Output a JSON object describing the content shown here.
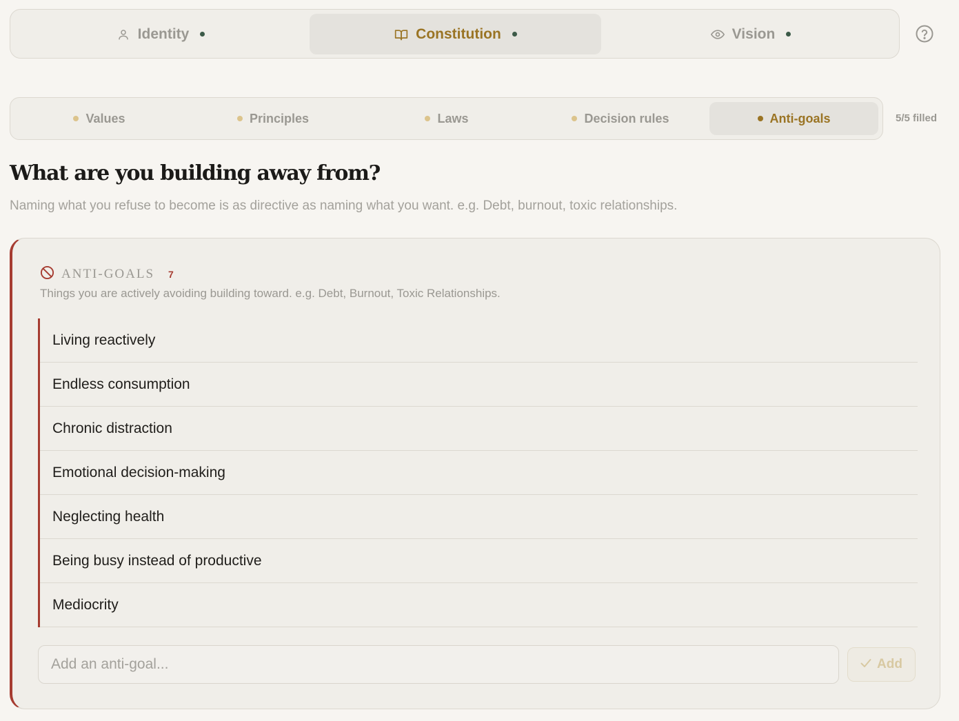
{
  "top_tabs": [
    {
      "label": "Identity",
      "icon": "person-icon",
      "active": false
    },
    {
      "label": "Constitution",
      "icon": "book-icon",
      "active": true
    },
    {
      "label": "Vision",
      "icon": "eye-icon",
      "active": false
    }
  ],
  "sub_tabs": [
    {
      "label": "Values",
      "active": false
    },
    {
      "label": "Principles",
      "active": false
    },
    {
      "label": "Laws",
      "active": false
    },
    {
      "label": "Decision rules",
      "active": false
    },
    {
      "label": "Anti-goals",
      "active": true
    }
  ],
  "filled_status": "5/5 filled",
  "heading": "What are you building away from?",
  "subheading": "Naming what you refuse to become is as directive as naming what you want. e.g. Debt, burnout, toxic relationships.",
  "card": {
    "title": "ANTI-GOALS",
    "count": "7",
    "description": "Things you are actively avoiding building toward. e.g. Debt, Burnout, Toxic Relationships.",
    "items": [
      "Living reactively",
      "Endless consumption",
      "Chronic distraction",
      "Emotional decision-making",
      "Neglecting health",
      "Being busy instead of productive",
      "Mediocrity"
    ],
    "input_placeholder": "Add an anti-goal...",
    "add_label": "Add"
  },
  "colors": {
    "accent_gold": "#9a7424",
    "accent_red": "#a63c31",
    "status_green": "#3c5a48",
    "background": "#f7f5f1"
  }
}
